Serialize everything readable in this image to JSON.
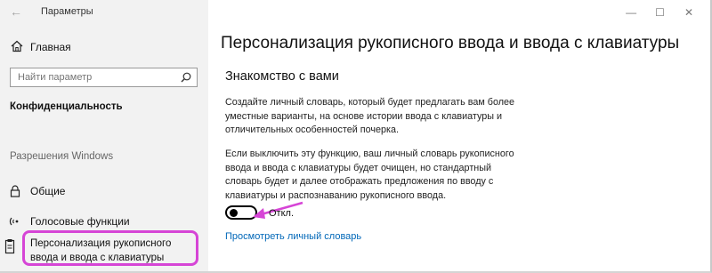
{
  "window": {
    "app_title": "Параметры",
    "controls": {
      "minimize": "—",
      "maximize": "☐",
      "close": "✕"
    }
  },
  "sidebar": {
    "home_label": "Главная",
    "search_placeholder": "Найти параметр",
    "section_heading": "Конфиденциальность",
    "group_heading": "Разрешения Windows",
    "items": [
      {
        "label": "Общие",
        "icon": "lock-icon"
      },
      {
        "label": "Голосовые функции",
        "icon": "voice-icon"
      },
      {
        "label": "Персонализация рукописного ввода и ввода с клавиатуры",
        "icon": "clipboard-icon",
        "active": true
      }
    ]
  },
  "main": {
    "title": "Персонализация рукописного ввода и ввода с клавиатуры",
    "subtitle": "Знакомство с вами",
    "paragraph1": "Создайте личный словарь, который будет предлагать вам более уместные варианты, на основе истории ввода с клавиатуры и отличительных особенностей почерка.",
    "paragraph2": "Если выключить эту функцию, ваш личный словарь рукописного ввода и ввода с клавиатуры будет очищен, но стандартный словарь будет и далее отображать предложения по вводу с клавиатуры и распознаванию рукописного ввода.",
    "toggle_state": "Откл.",
    "toggle_on": false,
    "link": "Просмотреть личный словарь"
  },
  "colors": {
    "sidebar_bg": "#f2f2f2",
    "highlight": "#d645d6",
    "link": "#0067b8"
  }
}
